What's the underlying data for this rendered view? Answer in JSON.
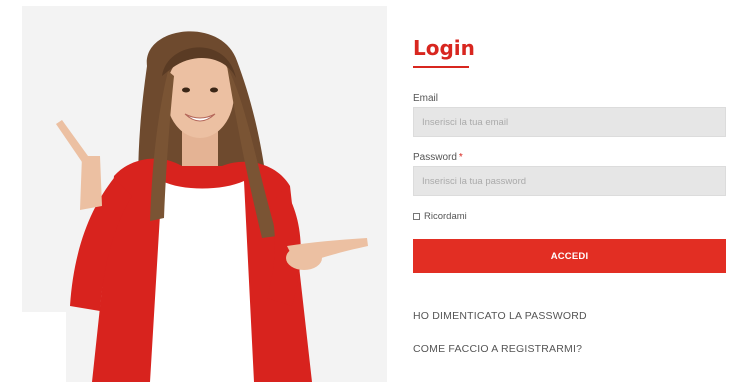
{
  "login": {
    "title": "Login",
    "email_label": "Email",
    "email_placeholder": "Inserisci la tua email",
    "email_value": "",
    "password_label": "Password",
    "password_required_mark": "*",
    "password_placeholder": "Inserisci la tua password",
    "password_value": "",
    "remember_label": "Ricordami",
    "remember_checked": false,
    "submit_label": "ACCEDI",
    "forgot_password_link": "HO DIMENTICATO LA PASSWORD",
    "register_link": "COME FACCIO A REGISTRARMI?"
  },
  "colors": {
    "accent": "#e22e23",
    "title": "#d8261f",
    "input_bg": "#e6e6e6",
    "text": "#555555"
  },
  "icons": {
    "remember_checkbox": "checkbox-empty-icon"
  }
}
